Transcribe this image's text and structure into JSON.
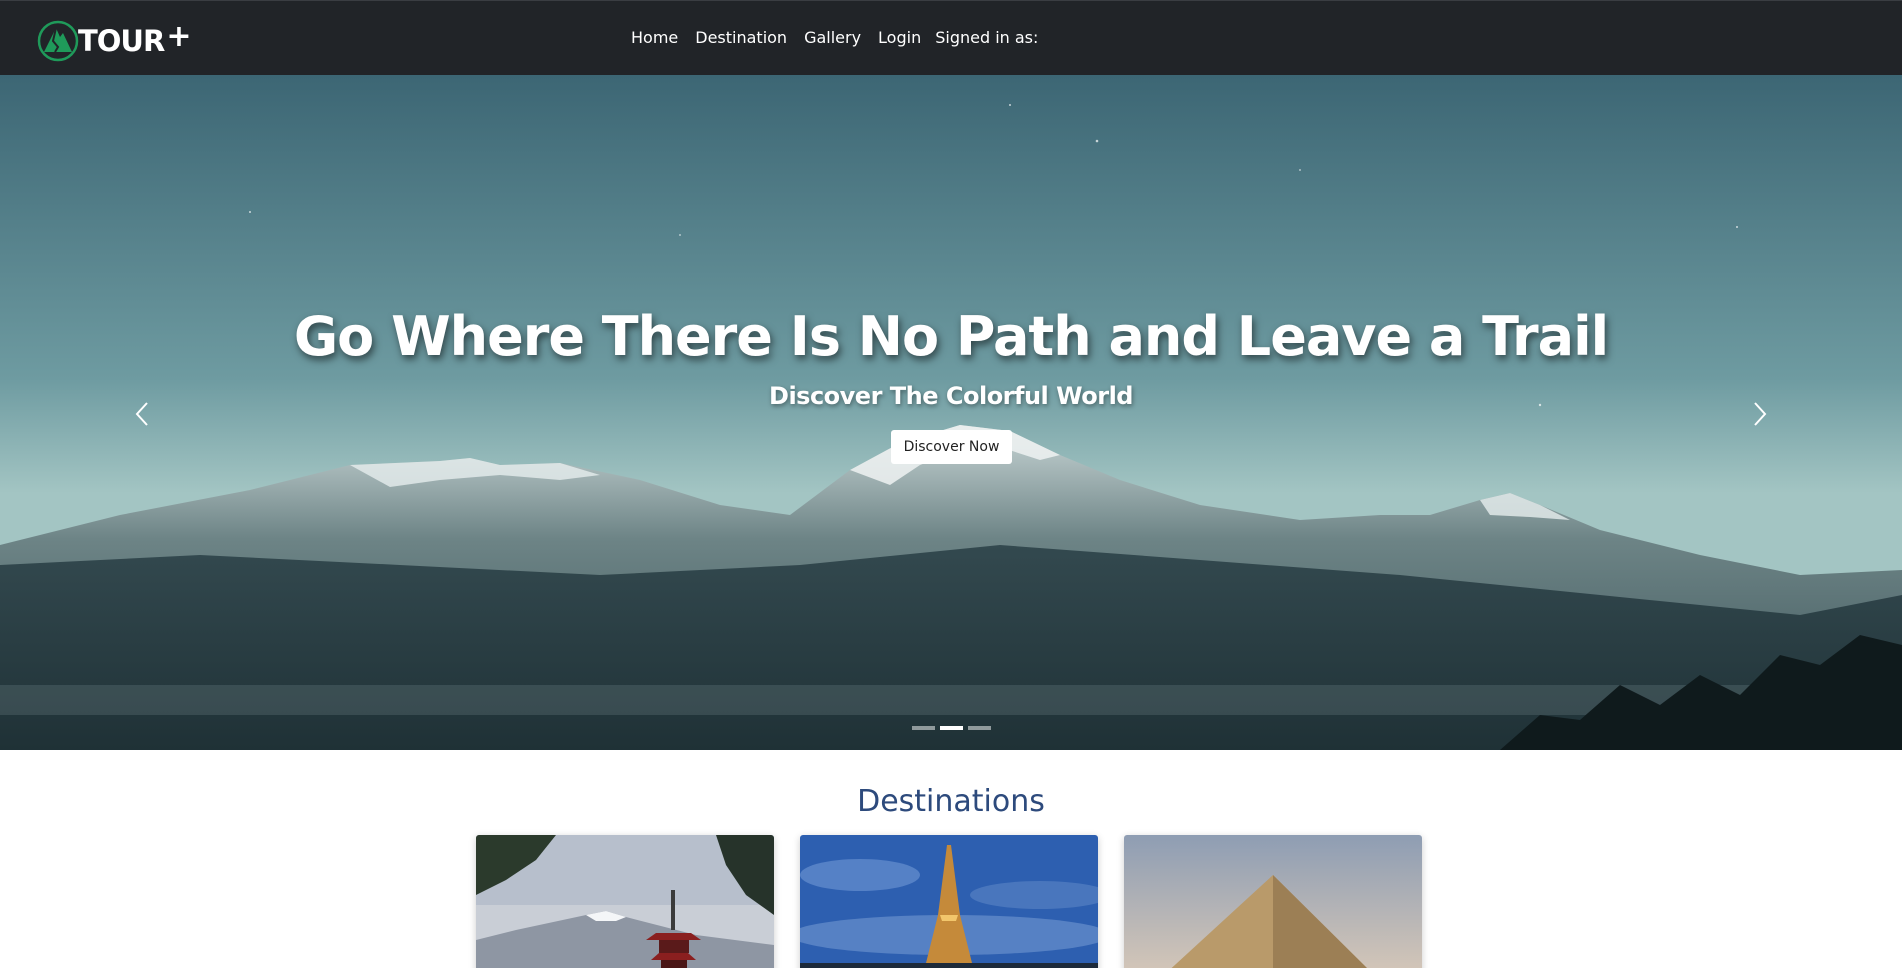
{
  "brand": {
    "name": "TOUR",
    "suffix": "+",
    "logo_icon": "mountain-circle-icon",
    "accent_color": "#1f9a5a"
  },
  "nav": {
    "items": [
      "Home",
      "Destination",
      "Gallery",
      "Login"
    ],
    "signed_in_label": "Signed in as:"
  },
  "hero": {
    "title": "Go Where There Is No Path and Leave a Trail",
    "subtitle": "Discover The Colorful World",
    "button_label": "Discover Now",
    "prev_icon": "chevron-left-icon",
    "next_icon": "chevron-right-icon",
    "slide_count": 3,
    "active_slide": 2
  },
  "destinations": {
    "title": "Destinations",
    "cards": [
      {
        "image": "japan-pagoda-mount-fuji"
      },
      {
        "image": "paris-eiffel-tower"
      },
      {
        "image": "egypt-pyramid"
      }
    ]
  },
  "colors": {
    "navbar_bg": "#212428",
    "section_title": "#2d4a7c"
  }
}
